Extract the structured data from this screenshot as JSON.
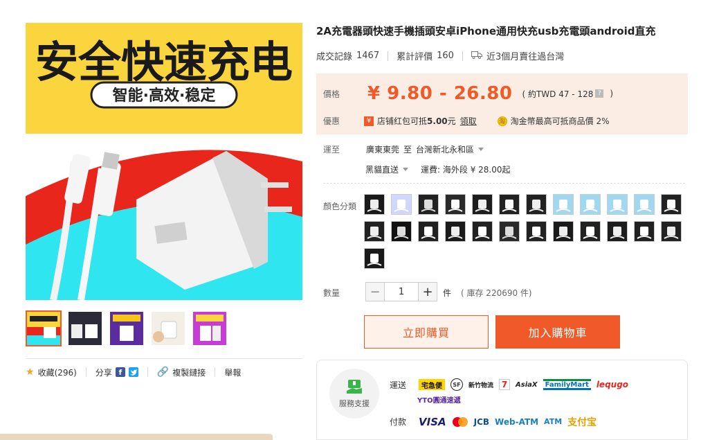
{
  "product": {
    "title": "2A充電器頭快速手機插頭安卓iPhone通用快充usb充電頭android直充",
    "main_image": {
      "headline": "安全快速充电",
      "tagline": "智能·高效·稳定"
    }
  },
  "stats": {
    "sales_label": "成交記錄",
    "sales_value": "1467",
    "reviews_label": "累計評價",
    "reviews_value": "160",
    "shipped_text": "近3個月賣往過台灣"
  },
  "price": {
    "label": "價格",
    "range": "¥ 9.80 - 26.80",
    "twd_note": "( 約TWD 47 - 128",
    "twd_close": ")",
    "help_glyph": "?"
  },
  "promo": {
    "label": "優惠",
    "coupon_text": "店铺红包可抵",
    "coupon_amount": "5.00",
    "coupon_unit": "元",
    "claim_label": "領取",
    "coin_text": "淘金幣最高可抵商品價 2%"
  },
  "shipping": {
    "label": "運至",
    "from": "廣東東莞",
    "to_word": "至",
    "dest": "台灣新北永和區",
    "method": "黑貓直送",
    "fee": "運費: 海外段 ¥ 28.00起"
  },
  "color": {
    "label": "顏色分類",
    "swatch_count": 25
  },
  "quantity": {
    "label": "數量",
    "value": "1",
    "minus": "−",
    "plus": "+",
    "unit": "件",
    "stock": "( 庫存 220690 件)"
  },
  "actions": {
    "buy_now": "立即購買",
    "add_to_cart": "加入購物車"
  },
  "share_bar": {
    "favorite": "收藏(296)",
    "share": "分享",
    "copy_link": "複製鏈接",
    "report": "舉報"
  },
  "service": {
    "label": "服務支援",
    "shipping_label": "運送",
    "payment_label": "付款",
    "shipping_logos": [
      "宅急便",
      "SF",
      "新竹物流",
      "7-ELEVEn",
      "AsiaX",
      "FamilyMart",
      "lequgo",
      "YTO圓通速遞"
    ],
    "payment_logos": [
      "VISA",
      "MasterCard",
      "JCB",
      "Web-ATM",
      "ATM",
      "支付宝"
    ]
  },
  "colors": {
    "accent": "#f05a28",
    "price_bg": "#fbede4"
  }
}
